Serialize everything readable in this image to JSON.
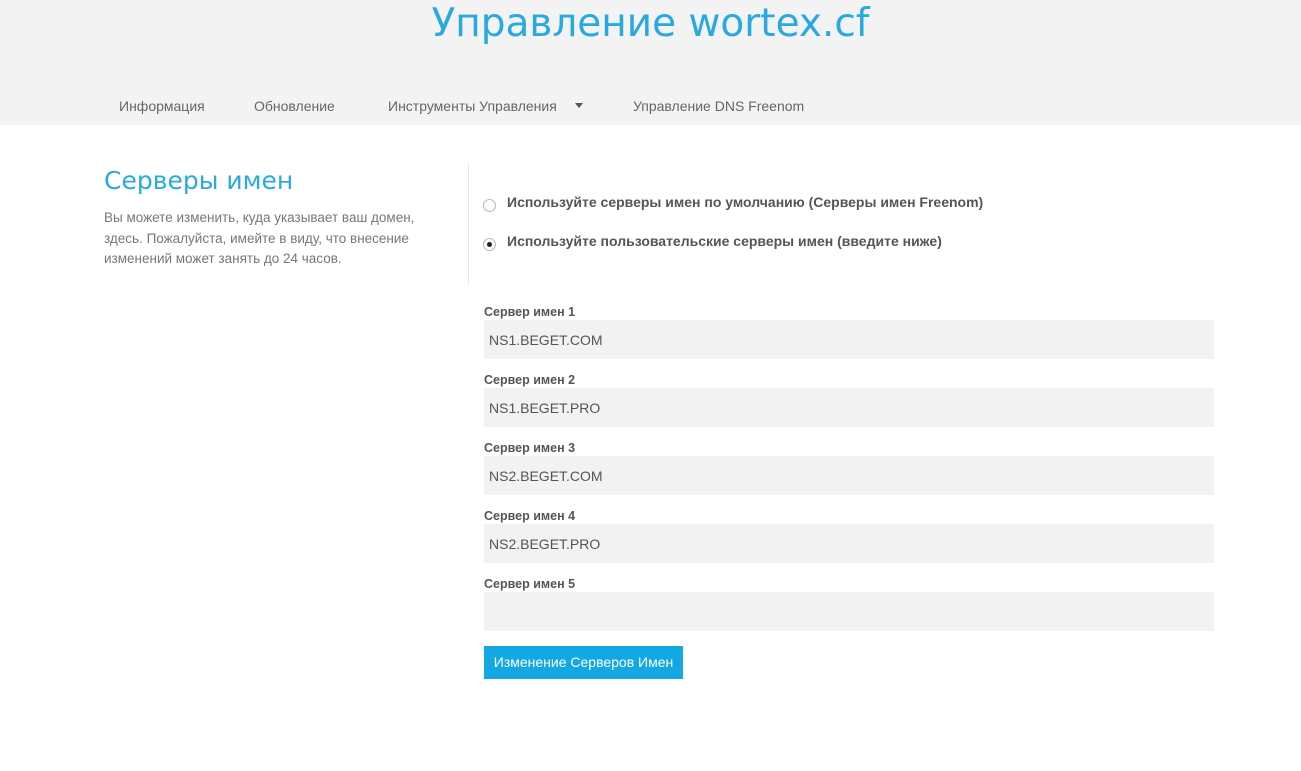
{
  "header": {
    "title": "Управление wortex.cf"
  },
  "nav": {
    "items": [
      {
        "label": "Информация"
      },
      {
        "label": "Обновление"
      },
      {
        "label": "Инструменты Управления"
      },
      {
        "label": "Управление DNS Freenom"
      }
    ]
  },
  "sidebar": {
    "title": "Серверы имен",
    "description": "Вы можете изменить, куда указывает ваш домен, здесь. Пожалуйста, имейте в виду, что внесение изменений может занять до 24 часов."
  },
  "options": {
    "default_label": "Используйте серверы имен по умолчанию (Серверы имен Freenom)",
    "custom_label": "Используйте пользовательские серверы имен (введите ниже)",
    "selected": "custom"
  },
  "nameservers": [
    {
      "label": "Сервер имен 1",
      "value": "NS1.BEGET.COM"
    },
    {
      "label": "Сервер имен 2",
      "value": "NS1.BEGET.PRO"
    },
    {
      "label": "Сервер имен 3",
      "value": "NS2.BEGET.COM"
    },
    {
      "label": "Сервер имен 4",
      "value": "NS2.BEGET.PRO"
    },
    {
      "label": "Сервер имен 5",
      "value": ""
    }
  ],
  "submit": {
    "label": "Изменение Серверов Имен"
  },
  "colors": {
    "accent": "#29a9e1",
    "button": "#13a8e3",
    "header_bg": "#f3f3f3",
    "input_bg": "#f2f2f2"
  },
  "icons": {
    "dropdown": "caret-down-icon"
  }
}
